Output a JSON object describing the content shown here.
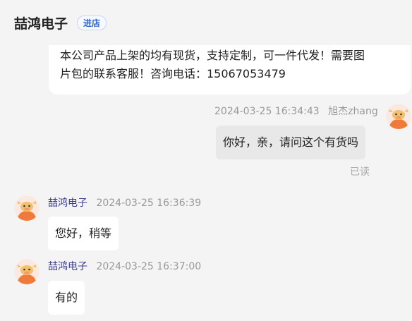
{
  "header": {
    "shop_name": "喆鸿电子",
    "enter_shop_label": "进店"
  },
  "messages": [
    {
      "type": "notice",
      "text_line1": "本公司产品上架的均有现货，支持定制，可一件代发！需要图",
      "text_line2": "片包的联系客服！咨询电话：15067053479"
    },
    {
      "type": "outgoing",
      "time": "2024-03-25 16:34:43",
      "sender": "旭杰zhang",
      "text": "你好，亲，请问这个有货吗",
      "status": "已读"
    },
    {
      "type": "incoming",
      "sender": "喆鸿电子",
      "time": "2024-03-25 16:36:39",
      "text": "您好，稍等"
    },
    {
      "type": "incoming",
      "sender": "喆鸿电子",
      "time": "2024-03-25 16:37:00",
      "text": "有的"
    }
  ],
  "colors": {
    "background": "#f4f4f4",
    "bubble_incoming": "#ffffff",
    "bubble_outgoing": "#e8e8e8",
    "sender_name": "#3a3a8c",
    "enter_shop_accent": "#3366cc",
    "avatar_orange": "#f07a3a"
  },
  "icons": {
    "avatar": "cartoon-cow-avatar-icon"
  }
}
